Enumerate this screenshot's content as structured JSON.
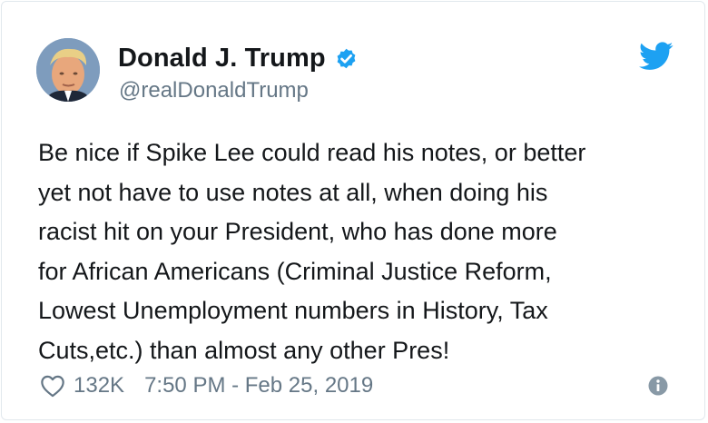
{
  "author": {
    "display_name": "Donald J. Trump",
    "handle": "@realDonaldTrump",
    "verified": true,
    "verified_icon": "verified-badge-icon",
    "avatar": "profile-photo"
  },
  "brand": {
    "icon": "twitter-bird-icon",
    "color": "#1da1f2"
  },
  "tweet": {
    "lines": [
      "Be nice if Spike Lee could read his notes, or better",
      "yet not have to use notes at all, when doing his",
      "racist hit on your President, who has done more",
      "for African Americans (Criminal Justice Reform,",
      "Lowest Unemployment numbers in History, Tax",
      "Cuts,etc.) than almost any other Pres!"
    ]
  },
  "footer": {
    "like_icon": "heart-icon",
    "like_count": "132K",
    "timestamp": "7:50 PM - Feb 25, 2019",
    "info_icon": "info-icon"
  },
  "colors": {
    "text_primary": "#14171a",
    "text_secondary": "#657786",
    "border": "#e1e8ed",
    "verified_blue": "#1da1f2"
  }
}
